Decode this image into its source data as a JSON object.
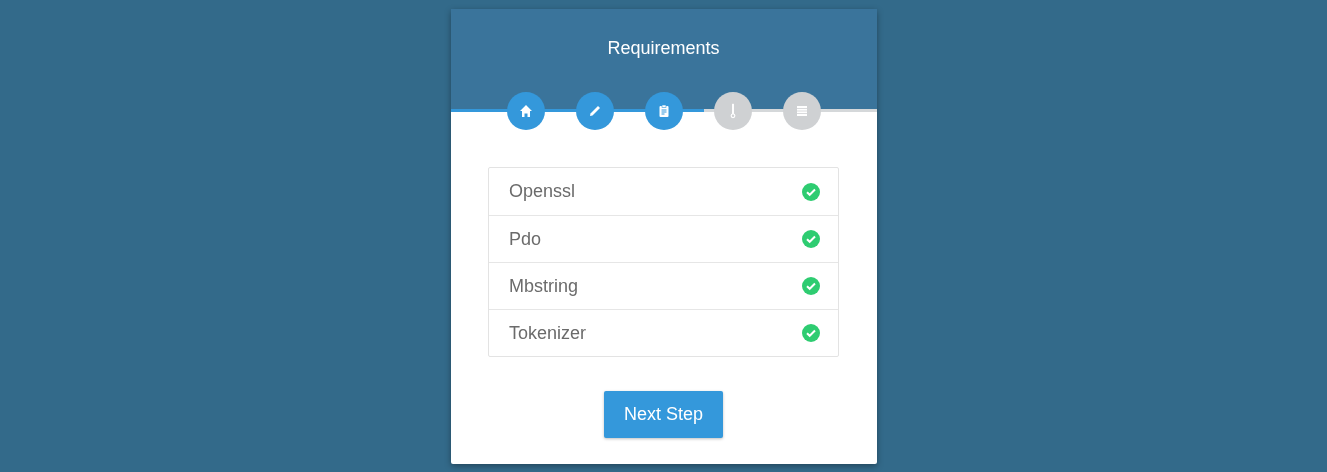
{
  "title": "Requirements",
  "steps": [
    {
      "kind": "home",
      "done": true
    },
    {
      "kind": "pencil",
      "done": true
    },
    {
      "kind": "clipboard",
      "done": true
    },
    {
      "kind": "thermometer",
      "done": false
    },
    {
      "kind": "list",
      "done": false
    }
  ],
  "requirements": [
    {
      "name": "Openssl",
      "met": true
    },
    {
      "name": "Pdo",
      "met": true
    },
    {
      "name": "Mbstring",
      "met": true
    },
    {
      "name": "Tokenizer",
      "met": true
    }
  ],
  "next_button": "Next Step"
}
